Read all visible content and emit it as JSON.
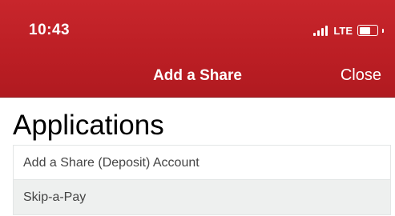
{
  "status_bar": {
    "time": "10:43",
    "network": "LTE",
    "battery_level": 0.75
  },
  "nav": {
    "title": "Add a Share",
    "close_label": "Close"
  },
  "colors": {
    "header_red": "#bb1e24",
    "header_text": "#ffffff",
    "row_alt": "#eef0ef"
  },
  "page": {
    "heading": "Applications"
  },
  "applications": [
    {
      "label": "Add a Share (Deposit) Account"
    },
    {
      "label": "Skip-a-Pay"
    }
  ]
}
